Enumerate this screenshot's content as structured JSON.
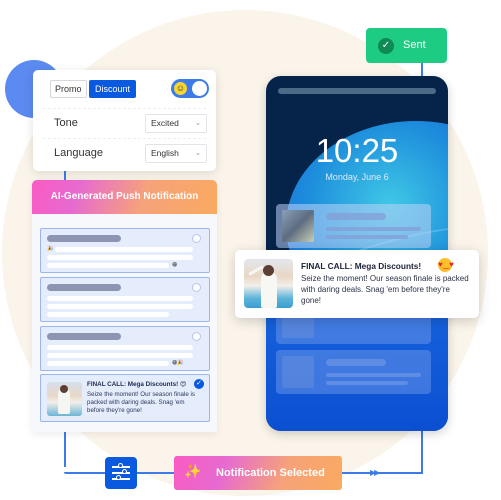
{
  "settings": {
    "chips": [
      {
        "label": "Promo",
        "active": false
      },
      {
        "label": "Discount",
        "active": true
      }
    ],
    "emoji_toggle": {
      "icon": "smiley-icon",
      "glyph": "☺",
      "on": true
    },
    "rows": [
      {
        "label": "Tone",
        "value": "Excited"
      },
      {
        "label": "Language",
        "value": "English"
      }
    ],
    "chevron_glyph": "⌄"
  },
  "ai_panel": {
    "title": "AI-Generated Push Notification",
    "options_placeholder_count": 3,
    "selected_option": {
      "title": "FINAL CALL: Mega Discounts! 😍",
      "body": "Seize the moment! Our season finale is packed with daring deals. Snag 'em before they're gone!",
      "check_glyph": "✓"
    }
  },
  "phone": {
    "time": "10:25",
    "date": "Monday, June 6"
  },
  "notification": {
    "title": "FINAL CALL: Mega Discounts!",
    "emoji": "♥‿♥",
    "body": "Seize the moment! Our season finale is packed with daring deals. Snag 'em before they're gone!"
  },
  "status": {
    "sent_label": "Sent",
    "check_glyph": "✓"
  },
  "flow": {
    "selected_label": "Notification Selected",
    "wand_glyph": "✨",
    "arrows_glyph": "▶▶"
  },
  "colors": {
    "accent_blue": "#0a5ae0",
    "sent_green": "#1ecb82",
    "gradient_pink": "#f95bc3",
    "gradient_orange": "#fbaa60"
  }
}
